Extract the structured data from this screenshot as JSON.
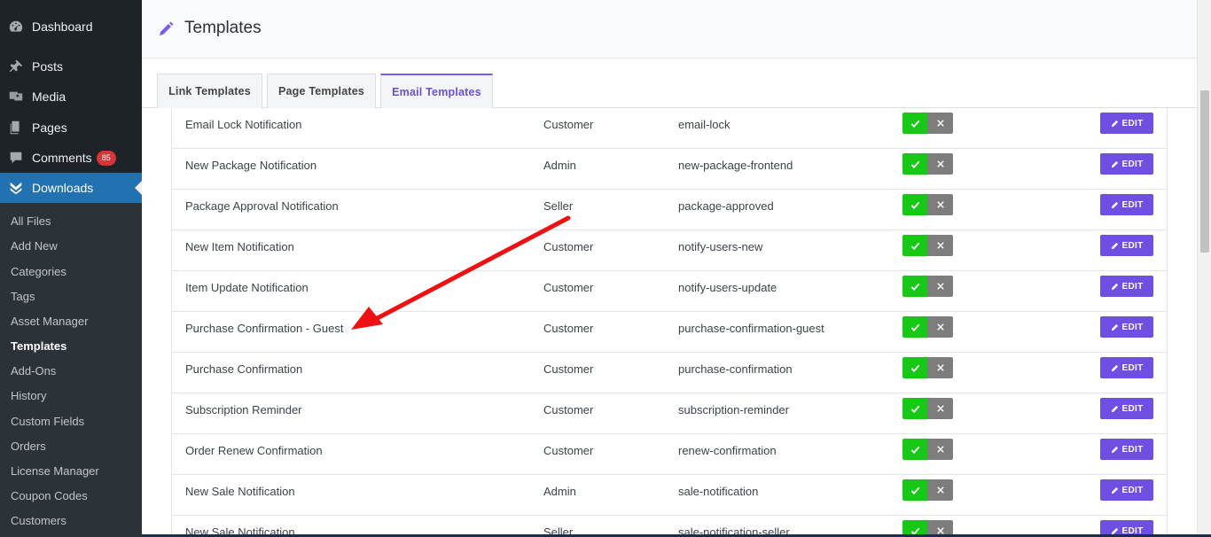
{
  "sidebar": {
    "menu": [
      {
        "label": "Dashboard",
        "icon": "dashboard-icon",
        "badge": ""
      },
      {
        "label": "Posts",
        "icon": "pin-icon",
        "badge": ""
      },
      {
        "label": "Media",
        "icon": "media-icon",
        "badge": ""
      },
      {
        "label": "Pages",
        "icon": "pages-icon",
        "badge": ""
      },
      {
        "label": "Comments",
        "icon": "comment-icon",
        "badge": "85"
      },
      {
        "label": "Downloads",
        "icon": "downloads-icon",
        "badge": ""
      }
    ],
    "submenu": [
      "All Files",
      "Add New",
      "Categories",
      "Tags",
      "Asset Manager",
      "Templates",
      "Add-Ons",
      "History",
      "Custom Fields",
      "Orders",
      "License Manager",
      "Coupon Codes",
      "Customers"
    ],
    "active_menu": "Downloads",
    "current_submenu": "Templates"
  },
  "header": {
    "title": "Templates"
  },
  "tabs": [
    {
      "label": "Link Templates",
      "active": false
    },
    {
      "label": "Page Templates",
      "active": false
    },
    {
      "label": "Email Templates",
      "active": true
    }
  ],
  "table": {
    "edit_label": "EDIT",
    "rows": [
      {
        "name": "Email Lock Notification",
        "role": "Customer",
        "id": "email-lock"
      },
      {
        "name": "New Package Notification",
        "role": "Admin",
        "id": "new-package-frontend"
      },
      {
        "name": "Package Approval Notification",
        "role": "Seller",
        "id": "package-approved"
      },
      {
        "name": "New Item Notification",
        "role": "Customer",
        "id": "notify-users-new"
      },
      {
        "name": "Item Update Notification",
        "role": "Customer",
        "id": "notify-users-update"
      },
      {
        "name": "Purchase Confirmation - Guest",
        "role": "Customer",
        "id": "purchase-confirmation-guest"
      },
      {
        "name": "Purchase Confirmation",
        "role": "Customer",
        "id": "purchase-confirmation"
      },
      {
        "name": "Subscription Reminder",
        "role": "Customer",
        "id": "subscription-reminder"
      },
      {
        "name": "Order Renew Confirmation",
        "role": "Customer",
        "id": "renew-confirmation"
      },
      {
        "name": "New Sale Notification",
        "role": "Admin",
        "id": "sale-notification"
      },
      {
        "name": "New Sale Notification",
        "role": "Seller",
        "id": "sale-notification-seller"
      }
    ]
  },
  "colors": {
    "accent": "#6f4ee2",
    "toggle_on": "#17c817",
    "toggle_off": "#7d7d7d",
    "annotation_arrow": "#ee1111"
  }
}
